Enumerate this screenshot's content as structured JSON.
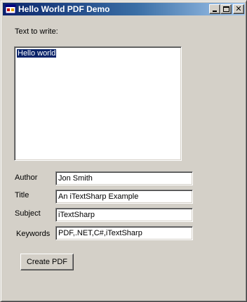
{
  "window": {
    "title": "Hello World PDF Demo",
    "minimize_icon": "minimize-icon",
    "maximize_icon": "maximize-icon",
    "close_icon": "close-icon",
    "close_glyph": "✕"
  },
  "form": {
    "text_label": "Text to write:",
    "text_value": "Hello world",
    "author_label": "Author",
    "author_value": "Jon Smith",
    "title_label": "Title",
    "title_value": "An iTextSharp Example",
    "subject_label": "Subject",
    "subject_value": "iTextSharp",
    "keywords_label": "Keywords",
    "keywords_value": "PDF,.NET,C#,iTextSharp",
    "create_button": "Create PDF"
  }
}
